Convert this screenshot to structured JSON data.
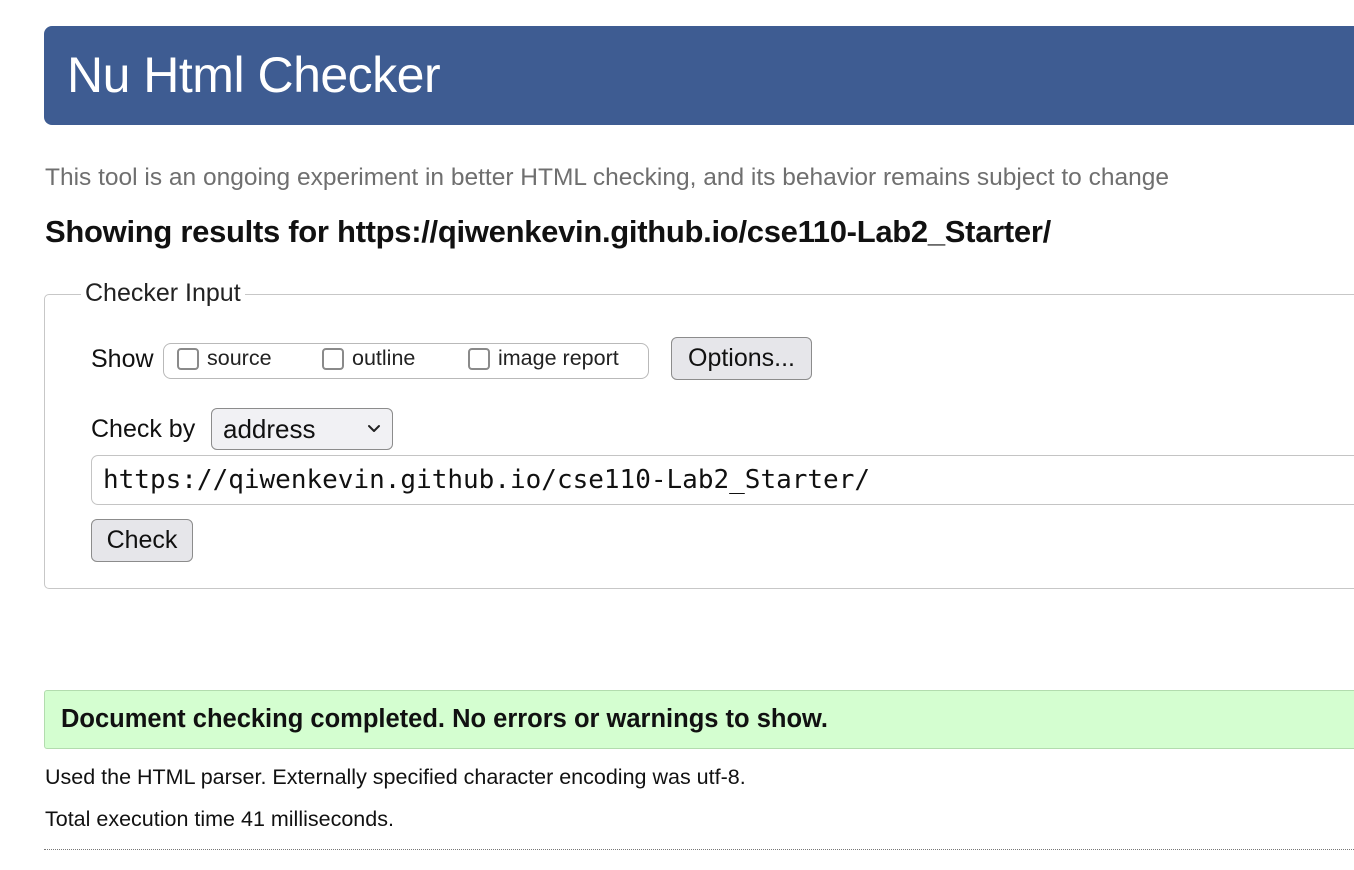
{
  "header": {
    "title": "Nu Html Checker",
    "background_color": "#3e5c92"
  },
  "tagline": "This tool is an ongoing experiment in better HTML checking, and its behavior remains subject to change",
  "results_heading": "Showing results for https://qiwenkevin.github.io/cse110-Lab2_Starter/",
  "checker_input": {
    "legend": "Checker Input",
    "show_label": "Show",
    "show_options": [
      {
        "label": "source",
        "checked": false
      },
      {
        "label": "outline",
        "checked": false
      },
      {
        "label": "image report",
        "checked": false
      }
    ],
    "options_button": "Options...",
    "check_by_label": "Check by",
    "check_by_selected": "address",
    "url_value": "https://qiwenkevin.github.io/cse110-Lab2_Starter/",
    "check_button": "Check"
  },
  "result": {
    "success_message": "Document checking completed. No errors or warnings to show.",
    "success_color": "#d4fed0",
    "parser_info": "Used the HTML parser. Externally specified character encoding was utf-8.",
    "execution_time": "Total execution time 41 milliseconds."
  }
}
